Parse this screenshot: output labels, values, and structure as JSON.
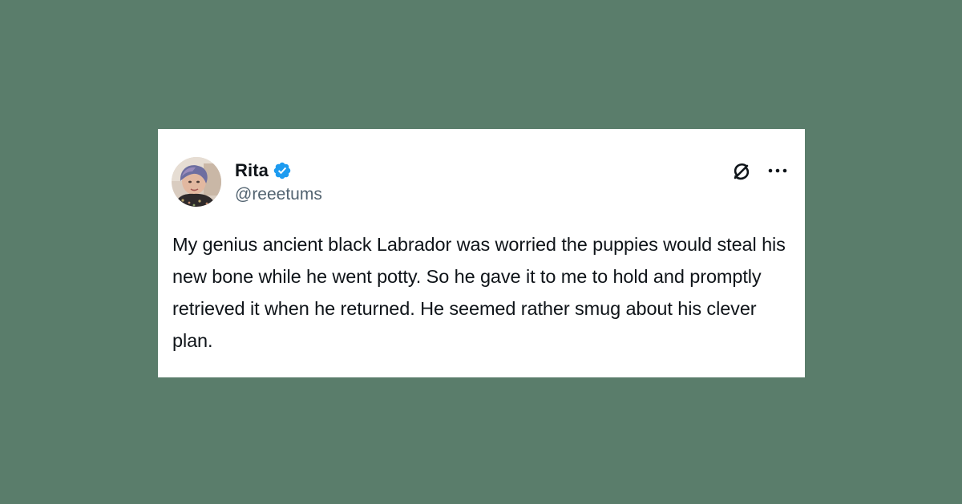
{
  "colors": {
    "background": "#5a7d6b",
    "card": "#ffffff",
    "text_primary": "#0f1419",
    "text_secondary": "#536471",
    "verified_blue": "#1d9bf0"
  },
  "tweet": {
    "author": {
      "display_name": "Rita",
      "handle": "@reeetums",
      "verified": true,
      "avatar_icon": "profile-photo"
    },
    "actions": {
      "grok_icon": "grok-icon",
      "more_icon": "more-horizontal-icon"
    },
    "text": "My genius ancient black Labrador was worried the puppies would steal his new bone while he went potty. So he gave it to me to hold and promptly retrieved it when he returned. He seemed rather smug about his clever plan."
  }
}
